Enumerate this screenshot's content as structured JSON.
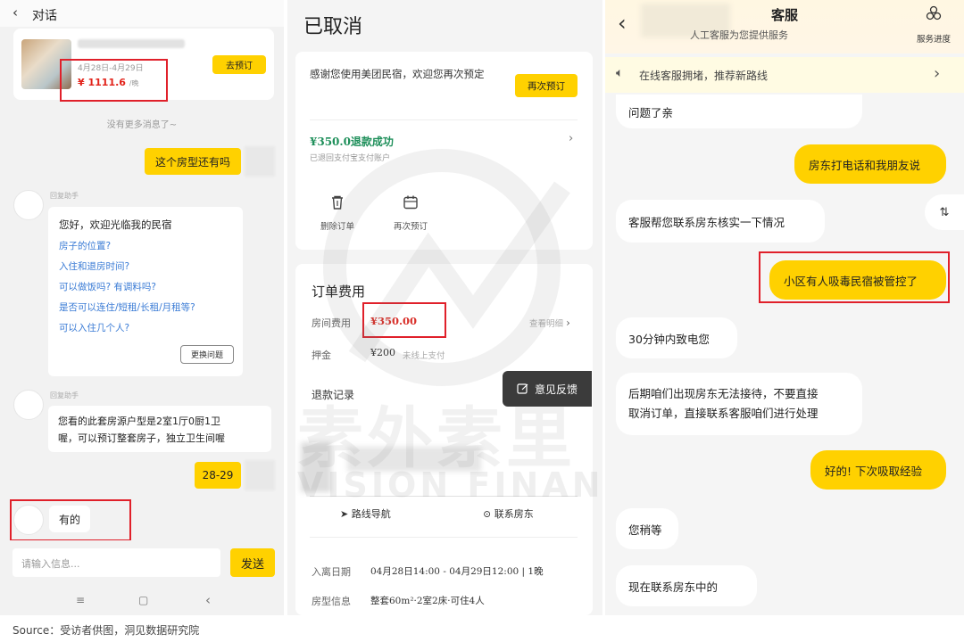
{
  "left_chat": {
    "back_icon": "‹",
    "title": "对话",
    "room_card": {
      "dates": "4月28日-4月29日",
      "price": "¥ 1111.6",
      "price_unit": "/晚",
      "book_button": "去预订"
    },
    "no_more": "没有更多消息了~",
    "messages": {
      "user_ask": "这个房型还有吗",
      "helper_label_1": "回复助手",
      "greeting": "您好，欢迎光临我的民宿",
      "questions": [
        "房子的位置?",
        "入住和退房时间?",
        "可以做饭吗? 有调料吗?",
        "是否可以连住/短租/长租/月租等?",
        "可以入住几个人?"
      ],
      "change_button": "更换问题",
      "helper_label_2": "回复助手",
      "room_type_line1": "您看的此套房源户型是2室1厅0厨1卫",
      "room_type_line2": "喔，可以预订整套房子，独立卫生间喔",
      "user_dates": "28-29",
      "host_reply": "有的"
    },
    "input_placeholder": "请输入信息...",
    "send_button": "发送",
    "nav": [
      "≡",
      "▢",
      "‹"
    ]
  },
  "order": {
    "status": "已取消",
    "thanks": "感谢您使用美团民宿，欢迎您再次预定",
    "rebook_button": "再次预订",
    "refund_success": "¥350.0退款成功",
    "refund_sub": "已退回支付宝支付账户",
    "actions": [
      {
        "icon": "🗑",
        "label": "删除订单"
      },
      {
        "icon": "🗓",
        "label": "再次预订"
      }
    ],
    "fee_title": "订单费用",
    "room_fee_key": "房间费用",
    "room_fee_val": "¥350.00",
    "detail_link": "查看明细",
    "deposit_key": "押金",
    "deposit_val": "¥200",
    "deposit_note": "未线上支付",
    "refund_record": "退款记录",
    "feedback": "意见反馈",
    "route_nav": "路线导航",
    "contact_host": "联系房东",
    "checkin_key": "入离日期",
    "checkin_val": "04月28日14:00 - 04月29日12:00 | 1晚",
    "roomtype_key": "房型信息",
    "roomtype_val": "整套60m²·2室2床·可住4人",
    "watermark_cn": "素外素里",
    "watermark_en": "VISION FINANCE"
  },
  "service_chat": {
    "title": "客服",
    "subtitle": "人工客服为您提供服务",
    "progress_icon": "service-progress-icon",
    "progress_label": "服务进度",
    "notice": "在线客服拥堵，推荐新路线",
    "messages": [
      {
        "side": "left",
        "text": "问题了亲"
      },
      {
        "side": "right",
        "text": "房东打电话和我朋友说"
      },
      {
        "side": "left",
        "text": "客服帮您联系房东核实一下情况"
      },
      {
        "side": "right",
        "text": "小区有人吸毒民宿被管控了"
      },
      {
        "side": "left",
        "text": "30分钟内致电您"
      },
      {
        "side": "left",
        "text": "后期咱们出现房东无法接待，不要直接",
        "text2": "取消订单，直接联系客服咱们进行处理"
      },
      {
        "side": "right",
        "text": "好的! 下次吸取经验"
      },
      {
        "side": "left",
        "text": "您稍等"
      },
      {
        "side": "left",
        "text": "现在联系房东中的"
      }
    ],
    "float_button": "⇅"
  },
  "source": "Source：受访者供图，洞见数据研究院",
  "colors": {
    "accent_yellow": "#ffd100",
    "highlight_red": "#e0202a",
    "refund_green": "#1e8f5a"
  }
}
